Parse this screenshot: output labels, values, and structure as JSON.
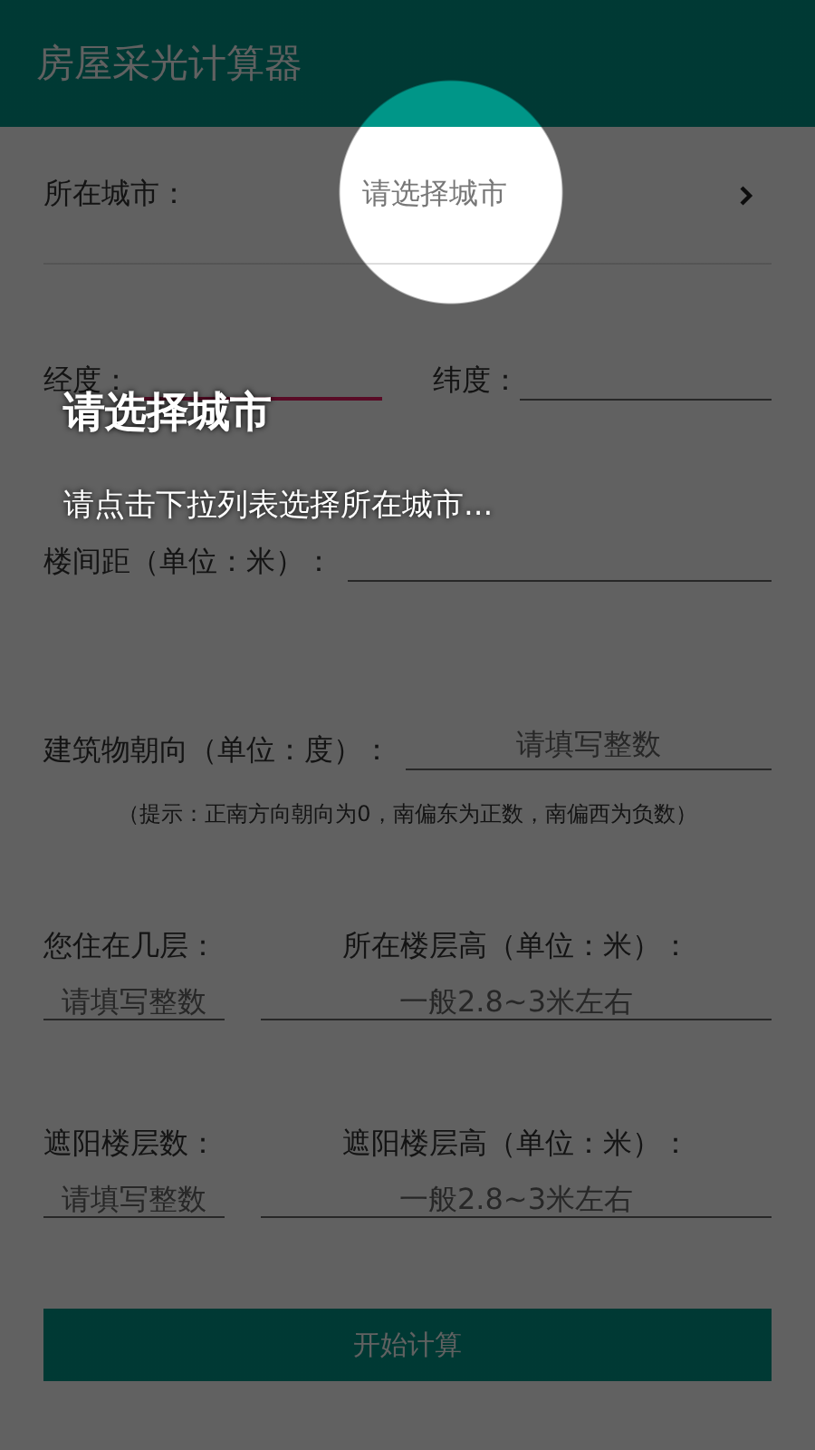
{
  "app_bar": {
    "title": "房屋采光计算器"
  },
  "city": {
    "label": "所在城市：",
    "value": "请选择城市"
  },
  "coordinates": [
    {
      "label": "经度：",
      "focused": true
    },
    {
      "label": "纬度：",
      "focused": false
    }
  ],
  "spacing": {
    "label": "楼间距（单位：米）：",
    "focused": false
  },
  "orientation": {
    "label": "建筑物朝向（单位：度）：",
    "placeholder": "请填写整数",
    "focused": false
  },
  "hint": "（提示：正南方向朝向为0，南偏东为正数，南偏西为负数）",
  "floor_rows": [
    {
      "fields": [
        {
          "label": "您住在几层：",
          "placeholder": "请填写整数",
          "focused": false
        },
        {
          "label": "所在楼层高（单位：米）：",
          "placeholder": "一般2.8~3米左右",
          "focused": false
        }
      ]
    },
    {
      "fields": [
        {
          "label": "遮阳楼层数：",
          "placeholder": "请填写整数",
          "focused": false
        },
        {
          "label": "遮阳楼层高（单位：米）：",
          "placeholder": "一般2.8~3米左右",
          "focused": false
        }
      ]
    }
  ],
  "button": "开始计算",
  "guide": {
    "title": "请选择城市",
    "message": "请点击下拉列表选择所在城市..."
  }
}
